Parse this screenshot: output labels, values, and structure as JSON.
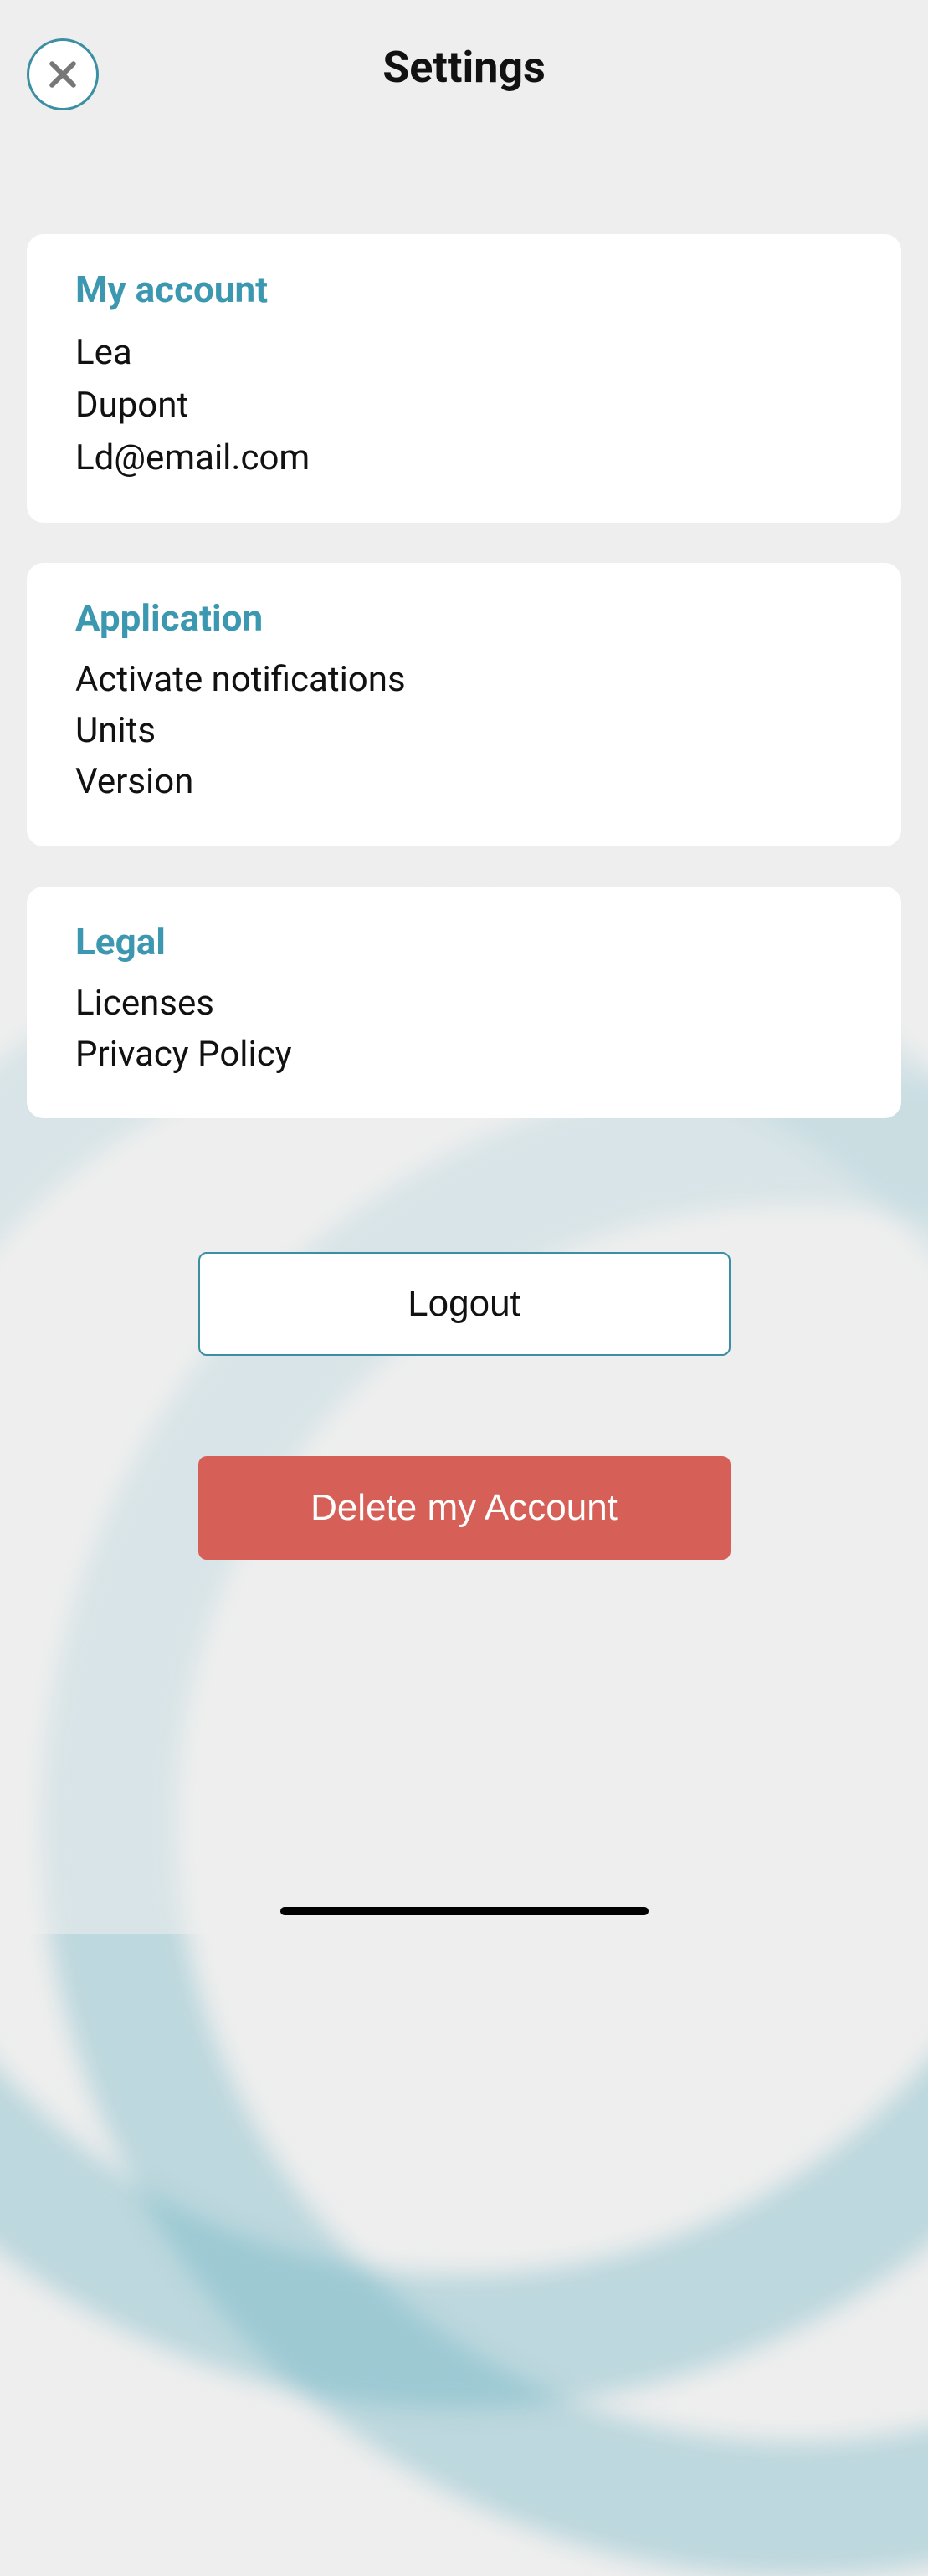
{
  "header": {
    "title": "Settings"
  },
  "account": {
    "section_title": "My account",
    "first_name": "Lea",
    "last_name": "Dupont",
    "email": "Ld@email.com"
  },
  "application": {
    "section_title": "Application",
    "items": [
      "Activate notifications",
      "Units",
      "Version"
    ]
  },
  "legal": {
    "section_title": "Legal",
    "items": [
      "Licenses",
      "Privacy Policy"
    ]
  },
  "buttons": {
    "logout": "Logout",
    "delete": "Delete my Account"
  },
  "colors": {
    "accent": "#3c98b0",
    "danger": "#d66058",
    "bg": "#eeeeee"
  }
}
